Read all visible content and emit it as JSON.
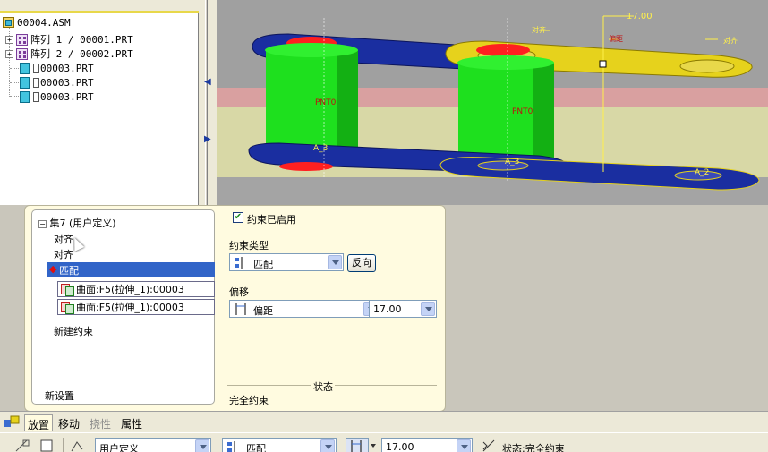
{
  "tree": {
    "items": [
      {
        "label": "00004.ASM",
        "icon": "assembly-icon"
      },
      {
        "label": "阵列 1 / 00001.PRT",
        "icon": "pattern-icon"
      },
      {
        "label": "阵列 2 / 00002.PRT",
        "icon": "pattern-icon"
      },
      {
        "label": "00003.PRT",
        "icon": "part-icon"
      },
      {
        "label": "00003.PRT",
        "icon": "part-icon"
      },
      {
        "label": "00003.PRT",
        "icon": "part-icon"
      }
    ]
  },
  "viewport": {
    "labels": {
      "dim": "17.00",
      "pnt_left": "PNT0",
      "pnt_right": "PNT0",
      "axis_bottom_left": "A_3",
      "axis_bottom_right": "A_3",
      "axis_right_end": "A_2",
      "flag_align": "对齐",
      "flag_offset": "偏距",
      "flag_align2": "对齐"
    },
    "colors": {
      "cylinder": "#1ee01e",
      "link": "#1a2ea0",
      "highlight": "#e6d21c",
      "selected_face": "#ff2020",
      "background": "#a0a0a0"
    }
  },
  "constraints": {
    "set_title": "集7 (用户定义)",
    "items": [
      "对齐",
      "对齐",
      "匹配"
    ],
    "references": [
      "曲面:F5(拉伸_1):00003",
      "曲面:F5(拉伸_1):00003"
    ],
    "new_constraint": "新建约束",
    "new_set": "新设置"
  },
  "settings": {
    "enabled_label": "约束已启用",
    "type_label": "约束类型",
    "type_value": "匹配",
    "reverse_button": "反向",
    "offset_label": "偏移",
    "offset_type": "偏距",
    "offset_value": "17.00",
    "status_label": "状态",
    "status_value": "完全约束"
  },
  "tabs": {
    "placement": "放置",
    "move": "移动",
    "flexibility": "挠性",
    "properties": "属性"
  },
  "toolbar": {
    "set_type": "用户定义",
    "constraint_type": "匹配",
    "offset_value": "17.00",
    "status_text": "状态:完全约束"
  }
}
